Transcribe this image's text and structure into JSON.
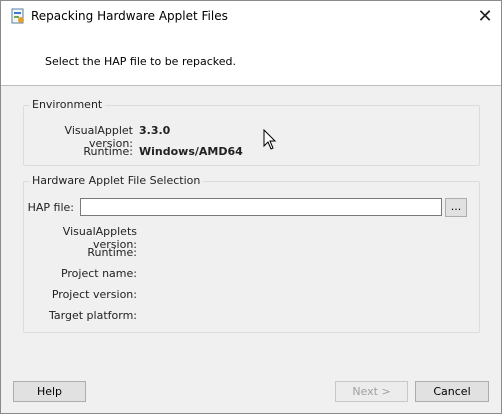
{
  "window": {
    "title": "Repacking Hardware Applet Files",
    "close_glyph": "✕"
  },
  "header": {
    "instruction": "Select the HAP file to be repacked."
  },
  "environment": {
    "group_title": "Environment",
    "visualapplet_version_label": "VisualApplet version:",
    "visualapplet_version_value": "3.3.0",
    "runtime_label": "Runtime:",
    "runtime_value": "Windows/AMD64"
  },
  "hap_selection": {
    "group_title": "Hardware Applet File Selection",
    "hap_file_label": "HAP file:",
    "hap_file_value": "",
    "browse_label": "...",
    "fields": [
      {
        "label": "VisualApplets version:"
      },
      {
        "label": "Runtime:"
      },
      {
        "label": "Project name:"
      },
      {
        "label": "Project version:"
      },
      {
        "label": "Target platform:"
      }
    ]
  },
  "buttons": {
    "help": "Help",
    "next": "Next >",
    "cancel": "Cancel"
  },
  "colors": {
    "dialog_bg": "#f0f0f0",
    "header_bg": "#ffffff",
    "button_bg": "#e1e1e1",
    "disabled_text": "#a0a0a0"
  }
}
